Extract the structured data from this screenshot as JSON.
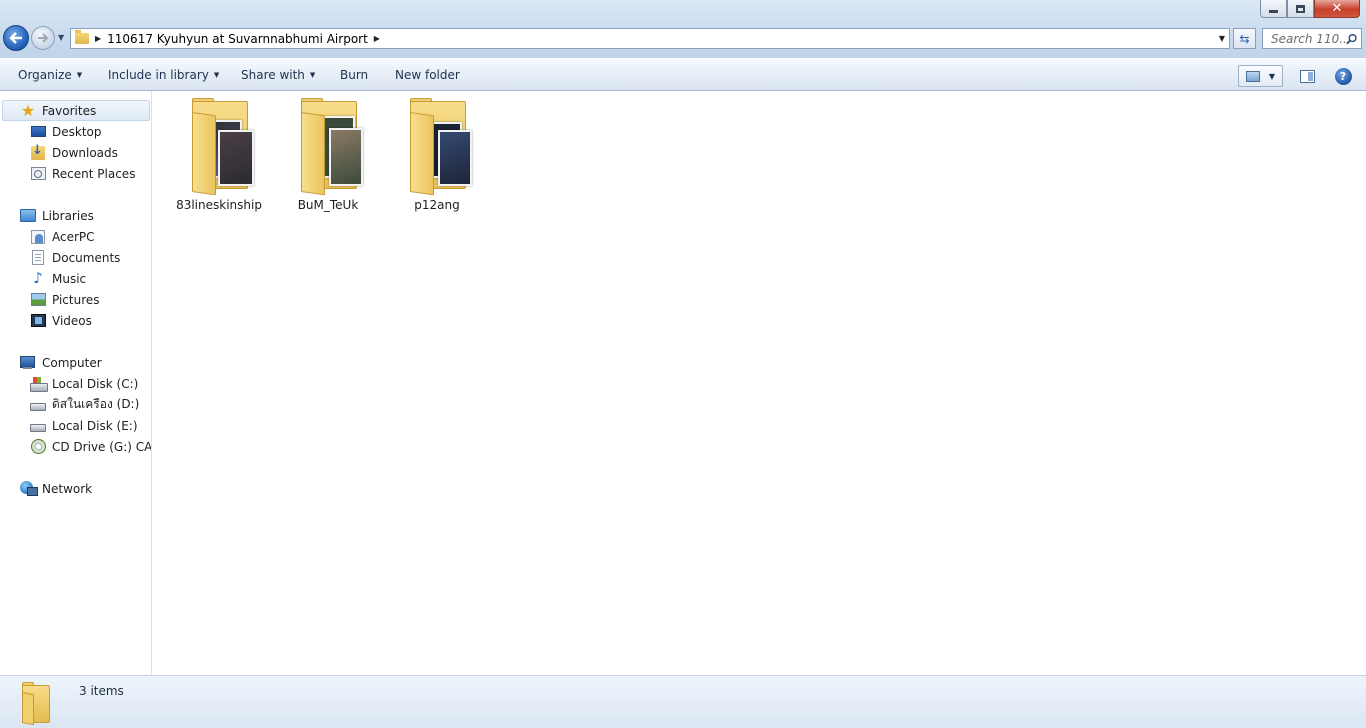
{
  "window": {
    "address_path": "110617 Kyuhyun at Suvarnnabhumi Airport",
    "search_placeholder": "Search 110...",
    "controls": {
      "minimize": "minimize",
      "maximize": "maximize",
      "close": "✕"
    }
  },
  "toolbar": {
    "organize": "Organize",
    "include_in_library": "Include in library",
    "share_with": "Share with",
    "burn": "Burn",
    "new_folder": "New folder"
  },
  "navigation": {
    "favorites": {
      "label": "Favorites",
      "items": [
        {
          "label": "Desktop",
          "icon": "desktop-icon"
        },
        {
          "label": "Downloads",
          "icon": "downloads-icon"
        },
        {
          "label": "Recent Places",
          "icon": "recent-places-icon"
        }
      ]
    },
    "libraries": {
      "label": "Libraries",
      "items": [
        {
          "label": "AcerPC",
          "icon": "user-library-icon"
        },
        {
          "label": "Documents",
          "icon": "documents-icon"
        },
        {
          "label": "Music",
          "icon": "music-icon"
        },
        {
          "label": "Pictures",
          "icon": "pictures-icon"
        },
        {
          "label": "Videos",
          "icon": "videos-icon"
        }
      ]
    },
    "computer": {
      "label": "Computer",
      "items": [
        {
          "label": "Local Disk (C:)",
          "icon": "system-drive-icon"
        },
        {
          "label": "ดิสในเครือง (D:)",
          "icon": "hard-drive-icon"
        },
        {
          "label": "Local Disk (E:)",
          "icon": "hard-drive-icon"
        },
        {
          "label": "CD Drive (G:) CAT (",
          "icon": "cd-drive-icon"
        }
      ]
    },
    "network": {
      "label": "Network",
      "icon": "network-icon"
    }
  },
  "content": {
    "folders": [
      {
        "name": "83lineskinship",
        "thumb_colors": [
          "#2b2b30",
          "#4a3f46",
          "#5f6a8a"
        ]
      },
      {
        "name": "BuM_TeUk",
        "thumb_colors": [
          "#3d4a3a",
          "#8a7a66",
          "#2f4f3f"
        ]
      },
      {
        "name": "p12ang",
        "thumb_colors": [
          "#1d2436",
          "#354a73",
          "#11182a"
        ]
      }
    ]
  },
  "status": {
    "item_count": "3 items"
  },
  "colors": {
    "accent": "#1f5cb3",
    "folder": "#e7bf55",
    "selection": "#dfeaf6"
  }
}
